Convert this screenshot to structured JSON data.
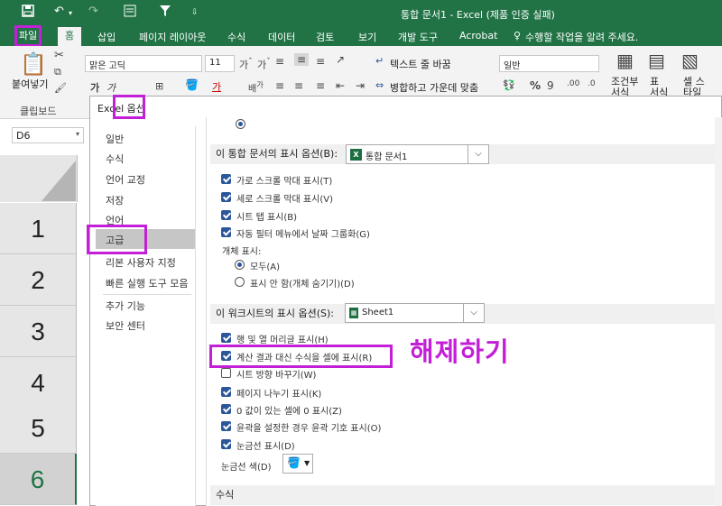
{
  "window": {
    "title": "통합 문서1 - Excel (제품 인증 실패)"
  },
  "quick_access": {
    "save_icon": "save-icon",
    "undo_icon": "undo-icon",
    "redo_icon": "redo-icon",
    "filter_icon": "filter-icon"
  },
  "ribbon": {
    "tabs": [
      "파일",
      "홈",
      "삽입",
      "페이지 레이아웃",
      "수식",
      "데이터",
      "검토",
      "보기",
      "개발 도구",
      "Acrobat"
    ],
    "tell_me": "수행할 작업을 알려 주세요.",
    "paste_label": "붙여넣기",
    "clipboard_label": "클립보드",
    "font_name": "맑은 고딕",
    "font_size": "11",
    "wrap_text": "텍스트 줄 바꿈",
    "merge_center": "병합하고 가운데 맞춤",
    "number_format": "일반",
    "conditional": "조건부 서식",
    "table_format": "표 서식",
    "cell_style": "셀 스타일"
  },
  "formula_bar": {
    "name_box": "D6"
  },
  "grid": {
    "rows": [
      "1",
      "2",
      "3",
      "4",
      "5",
      "6"
    ],
    "selected_row": "6"
  },
  "dialog": {
    "title_prefix": "Excel",
    "title": "옵션",
    "nav": [
      "일반",
      "수식",
      "언어 교정",
      "저장",
      "언어",
      "고급",
      "리본 사용자 지정",
      "빠른 실행 도구 모음",
      "추가 기능",
      "보안 센터"
    ],
    "selected_nav": "고급",
    "workbook_section": {
      "header": "이 통합 문서의 표시 옵션(B):",
      "dropdown": "통합 문서1",
      "options": [
        {
          "label": "가로 스크롤 막대 표시(T)",
          "checked": true
        },
        {
          "label": "세로 스크롤 막대 표시(V)",
          "checked": true
        },
        {
          "label": "시트 탭 표시(B)",
          "checked": true
        },
        {
          "label": "자동 필터 메뉴에서 날짜 그룹화(G)",
          "checked": true
        }
      ],
      "objects_label": "개체 표시:",
      "radio_all": "모두(A)",
      "radio_none": "표시 안 함(개체 숨기기)(D)"
    },
    "worksheet_section": {
      "header": "이 워크시트의 표시 옵션(S):",
      "dropdown": "Sheet1",
      "options": [
        {
          "label": "행 및 열 머리글 표시(H)",
          "checked": true
        },
        {
          "label": "계산 결과 대신 수식을 셀에 표시(R)",
          "checked": true
        },
        {
          "label": "시트 방향 바꾸기(W)",
          "checked": false
        },
        {
          "label": "페이지 나누기 표시(K)",
          "checked": true
        },
        {
          "label": "0 값이 있는 셀에 0 표시(Z)",
          "checked": true
        },
        {
          "label": "윤곽을 설정한 경우 윤곽 기호 표시(O)",
          "checked": true
        },
        {
          "label": "눈금선 표시(D)",
          "checked": true
        }
      ],
      "gridline_color_label": "눈금선 색(D)"
    },
    "formula_section_header": "수식"
  },
  "annotation": {
    "text": "해제하기"
  },
  "colors": {
    "excel_green": "#217346",
    "highlight": "#c21fd6",
    "check_blue": "#2b579a"
  }
}
